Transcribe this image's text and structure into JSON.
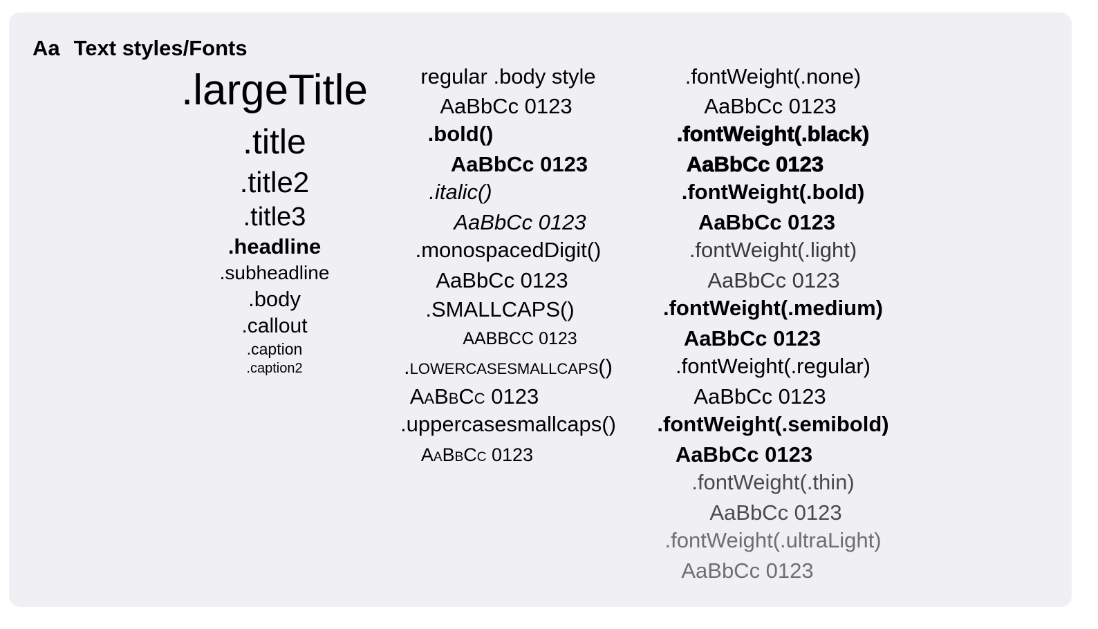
{
  "header": {
    "icon_text": "Aa",
    "title": "Text styles/Fonts"
  },
  "text_styles": [
    ".largeTitle",
    ".title",
    ".title2",
    ".title3",
    ".headline",
    ".subheadline",
    ".body",
    ".callout",
    ".caption",
    ".caption2"
  ],
  "modifiers": [
    ".bold()",
    ".italic()",
    ".monospacedDigit()",
    ".SMALLCAPS()",
    ".LOWERCASESMALLCAPS()",
    ".uppercasesmallcaps()"
  ],
  "modifiers_heading": "regular .body style",
  "weights": [
    ".fontWeight(.none)",
    ".fontWeight(.black)",
    ".fontWeight(.bold)",
    ".fontWeight(.light)",
    ".fontWeight(.medium)",
    ".fontWeight(.regular)",
    ".fontWeight(.semibold)",
    ".fontWeight(.thin)",
    ".fontWeight(.ultraLight)"
  ],
  "sample": "AaBbCc 0123",
  "colors": {
    "card_bg": "#f0eff4",
    "text": "#000000",
    "light_text": "#3a3a3c",
    "thin_text": "#6e6e73"
  }
}
